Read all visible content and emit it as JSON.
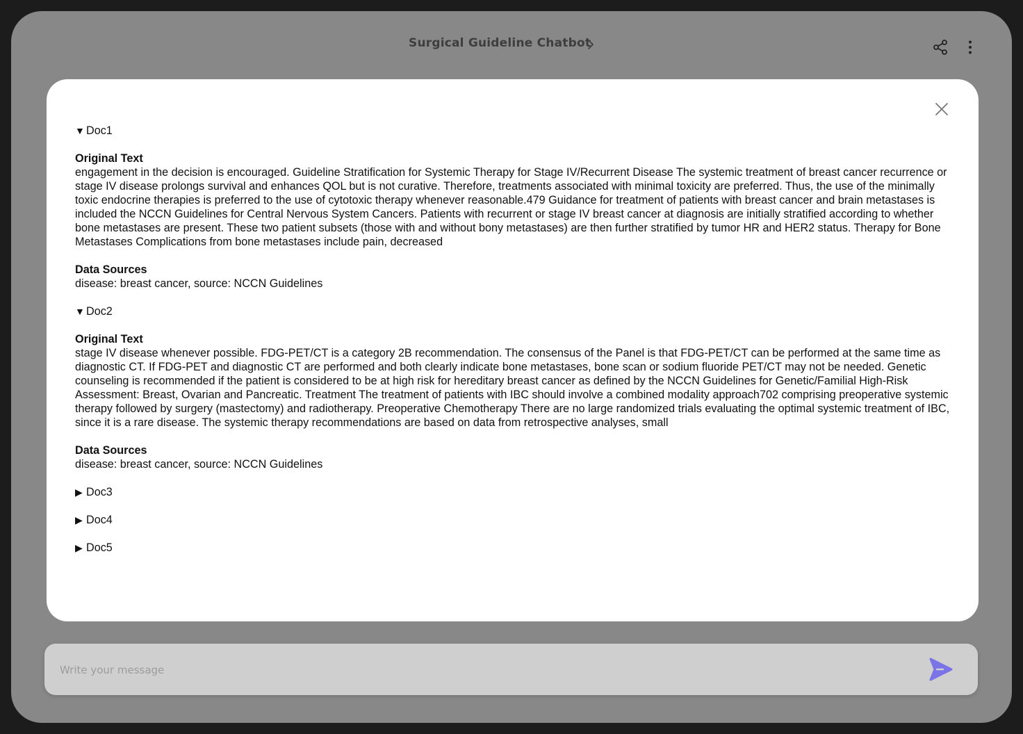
{
  "header": {
    "title": "Surgical Guideline Chatbot",
    "icons": [
      "chevron-right-icon",
      "share-icon",
      "more-vertical-icon"
    ]
  },
  "modal": {
    "close_icon": "close-icon",
    "docs": [
      {
        "label": "Doc1",
        "expanded": true,
        "original_text_heading": "Original Text",
        "original_text": "engagement in the decision is encouraged. Guideline Stratification for Systemic Therapy for Stage IV/Recurrent Disease The systemic treatment of breast cancer recurrence or stage IV disease prolongs survival and enhances QOL but is not curative. Therefore, treatments associated with minimal toxicity are preferred. Thus, the use of the minimally toxic endocrine therapies is preferred to the use of cytotoxic therapy whenever reasonable.479 Guidance for treatment of patients with breast cancer and brain metastases is included the NCCN Guidelines for Central Nervous System Cancers. Patients with recurrent or stage IV breast cancer at diagnosis are initially stratified according to whether bone metastases are present. These two patient subsets (those with and without bony metastases) are then further stratified by tumor HR and HER2 status. Therapy for Bone Metastases Complications from bone metastases include pain, decreased",
        "data_sources_heading": "Data Sources",
        "data_sources": "disease: breast cancer, source: NCCN Guidelines"
      },
      {
        "label": "Doc2",
        "expanded": true,
        "original_text_heading": "Original Text",
        "original_text": "stage IV disease whenever possible. FDG-PET/CT is a category 2B recommendation. The consensus of the Panel is that FDG-PET/CT can be performed at the same time as diagnostic CT. If FDG-PET and diagnostic CT are performed and both clearly indicate bone metastases, bone scan or sodium fluoride PET/CT may not be needed. Genetic counseling is recommended if the patient is considered to be at high risk for hereditary breast cancer as defined by the NCCN Guidelines for Genetic/Familial High-Risk Assessment: Breast, Ovarian and Pancreatic. Treatment The treatment of patients with IBC should involve a combined modality approach702 comprising preoperative systemic therapy followed by surgery (mastectomy) and radiotherapy. Preoperative Chemotherapy There are no large randomized trials evaluating the optimal systemic treatment of IBC, since it is a rare disease. The systemic therapy recommendations are based on data from retrospective analyses, small",
        "data_sources_heading": "Data Sources",
        "data_sources": "disease: breast cancer, source: NCCN Guidelines"
      },
      {
        "label": "Doc3",
        "expanded": false
      },
      {
        "label": "Doc4",
        "expanded": false
      },
      {
        "label": "Doc5",
        "expanded": false
      }
    ],
    "triangle_expanded": "▼",
    "triangle_collapsed": "▶"
  },
  "composer": {
    "placeholder": "Write your message",
    "send_icon": "send-icon",
    "send_color": "#7b74e8"
  }
}
